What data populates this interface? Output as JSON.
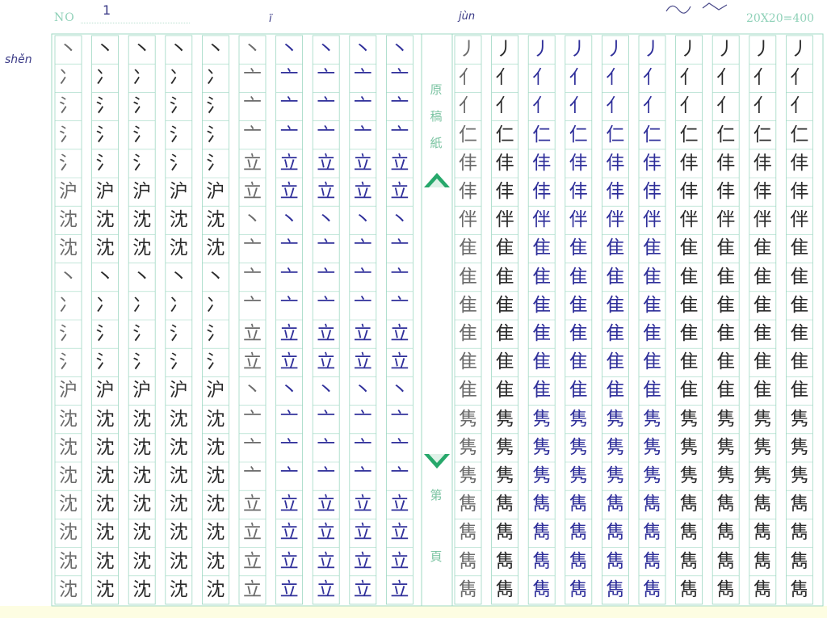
{
  "header": {
    "no_label": "NO",
    "count_label": "20X20=400"
  },
  "annotations": {
    "no_value": "1",
    "pinyin_left": "shěn",
    "pinyin_mid1": "ï",
    "pinyin_mid2": "jùn"
  },
  "gutter": {
    "top": [
      "原",
      "稿",
      "紙"
    ],
    "bottom": [
      "第",
      "頁"
    ]
  },
  "colors": {
    "grid_line": "#9fd8c3",
    "accent_green": "#7cc4a3",
    "ink_black": "#2b2b2b",
    "ink_blue": "#2f2f9a",
    "ink_faint": "#6b6b6b"
  },
  "rows": 20,
  "columns": [
    {
      "ink": "faint",
      "chars": [
        "丶",
        "冫",
        "氵",
        "氵",
        "氵⺄",
        "沪",
        "沈",
        "沈",
        "丶",
        "冫",
        "氵",
        "氵⺄",
        "沪",
        "沈",
        "沈",
        "沈",
        "沈",
        "沈",
        "沈",
        "沈"
      ]
    },
    {
      "ink": "black",
      "chars": [
        "丶",
        "冫",
        "氵",
        "氵",
        "氵⺄",
        "沪",
        "沈",
        "沈",
        "丶",
        "冫",
        "氵",
        "氵⺄",
        "沪",
        "沈",
        "沈",
        "沈",
        "沈",
        "沈",
        "沈",
        "沈"
      ]
    },
    {
      "ink": "black",
      "chars": [
        "丶",
        "冫",
        "氵",
        "氵",
        "氵⺄",
        "沪",
        "沈",
        "沈",
        "丶",
        "冫",
        "氵",
        "氵⺄",
        "沪",
        "沈",
        "沈",
        "沈",
        "沈",
        "沈",
        "沈",
        "沈"
      ]
    },
    {
      "ink": "black",
      "chars": [
        "丶",
        "冫",
        "氵",
        "氵",
        "氵⺄",
        "沪",
        "沈",
        "沈",
        "丶",
        "冫",
        "氵",
        "氵⺄",
        "沪",
        "沈",
        "沈",
        "沈",
        "沈",
        "沈",
        "沈",
        "沈"
      ]
    },
    {
      "ink": "black",
      "chars": [
        "丶",
        "冫",
        "氵",
        "氵",
        "氵⺄",
        "沪",
        "沈",
        "沈",
        "丶",
        "冫",
        "氵",
        "氵⺄",
        "沪",
        "沈",
        "沈",
        "沈",
        "沈",
        "沈",
        "沈",
        "沈"
      ]
    },
    {
      "ink": "faint",
      "chars": [
        "丶",
        "亠",
        "亠",
        "亠",
        "立",
        "立",
        "丶",
        "亠",
        "亠",
        "亠",
        "立",
        "立",
        "丶",
        "亠",
        "亠",
        "亠",
        "立",
        "立",
        "立",
        "立"
      ]
    },
    {
      "ink": "blue",
      "chars": [
        "丶",
        "亠",
        "亠",
        "亠",
        "立",
        "立",
        "丶",
        "亠",
        "亠",
        "亠",
        "立",
        "立",
        "丶",
        "亠",
        "亠",
        "亠",
        "立",
        "立",
        "立",
        "立"
      ]
    },
    {
      "ink": "blue",
      "chars": [
        "丶",
        "亠",
        "亠",
        "亠",
        "立",
        "立",
        "丶",
        "亠",
        "亠",
        "亠",
        "立",
        "立",
        "丶",
        "亠",
        "亠",
        "亠",
        "立",
        "立",
        "立",
        "立"
      ]
    },
    {
      "ink": "blue",
      "chars": [
        "丶",
        "亠",
        "亠",
        "亠",
        "立",
        "立",
        "丶",
        "亠",
        "亠",
        "亠",
        "立",
        "立",
        "丶",
        "亠",
        "亠",
        "亠",
        "立",
        "立",
        "立",
        "立"
      ]
    },
    {
      "ink": "blue",
      "chars": [
        "丶",
        "亠",
        "亠",
        "亠",
        "立",
        "立",
        "丶",
        "亠",
        "亠",
        "亠",
        "立",
        "立",
        "丶",
        "亠",
        "亠",
        "亠",
        "立",
        "立",
        "立",
        "立"
      ]
    },
    {
      "ink": "faint",
      "chars": [
        "丿",
        "亻",
        "亻",
        "仁",
        "仹",
        "仹",
        "伴",
        "隹",
        "隹",
        "隹",
        "隹",
        "隹",
        "隹",
        "隽",
        "隽",
        "隽",
        "雋",
        "雋",
        "雋",
        "雋"
      ]
    },
    {
      "ink": "black",
      "chars": [
        "丿",
        "亻",
        "亻",
        "仁",
        "仹",
        "仹",
        "伴",
        "隹",
        "隹",
        "隹",
        "隹",
        "隹",
        "隹",
        "隽",
        "隽",
        "隽",
        "雋",
        "雋",
        "雋",
        "雋"
      ]
    },
    {
      "ink": "blue",
      "chars": [
        "丿",
        "亻",
        "亻",
        "仁",
        "仹",
        "仹",
        "伴",
        "隹",
        "隹",
        "隹",
        "隹",
        "隹",
        "隹",
        "隽",
        "隽",
        "隽",
        "雋",
        "雋",
        "雋",
        "雋"
      ]
    },
    {
      "ink": "blue",
      "chars": [
        "丿",
        "亻",
        "亻",
        "仁",
        "仹",
        "仹",
        "伴",
        "隹",
        "隹",
        "隹",
        "隹",
        "隹",
        "隹",
        "隽",
        "隽",
        "隽",
        "雋",
        "雋",
        "雋",
        "雋"
      ]
    },
    {
      "ink": "blue",
      "chars": [
        "丿",
        "亻",
        "亻",
        "仁",
        "仹",
        "仹",
        "伴",
        "隹",
        "隹",
        "隹",
        "隹",
        "隹",
        "隹",
        "隽",
        "隽",
        "隽",
        "雋",
        "雋",
        "雋",
        "雋"
      ]
    },
    {
      "ink": "blue",
      "chars": [
        "丿",
        "亻",
        "亻",
        "仁",
        "仹",
        "仹",
        "伴",
        "隹",
        "隹",
        "隹",
        "隹",
        "隹",
        "隹",
        "隽",
        "隽",
        "隽",
        "雋",
        "雋",
        "雋",
        "雋"
      ]
    },
    {
      "ink": "black",
      "chars": [
        "丿",
        "亻",
        "亻",
        "仁",
        "仹",
        "仹",
        "伴",
        "隹",
        "隹",
        "隹",
        "隹",
        "隹",
        "隹",
        "隽",
        "隽",
        "隽",
        "雋",
        "雋",
        "雋",
        "雋"
      ]
    },
    {
      "ink": "black",
      "chars": [
        "丿",
        "亻",
        "亻",
        "仁",
        "仹",
        "仹",
        "伴",
        "隹",
        "隹",
        "隹",
        "隹",
        "隹",
        "隹",
        "隽",
        "隽",
        "隽",
        "雋",
        "雋",
        "雋",
        "雋"
      ]
    },
    {
      "ink": "black",
      "chars": [
        "丿",
        "亻",
        "亻",
        "仁",
        "仹",
        "仹",
        "伴",
        "隹",
        "隹",
        "隹",
        "隹",
        "隹",
        "隹",
        "隽",
        "隽",
        "隽",
        "雋",
        "雋",
        "雋",
        "雋"
      ]
    },
    {
      "ink": "black",
      "chars": [
        "丿",
        "亻",
        "亻",
        "仁",
        "仹",
        "仹",
        "伴",
        "隹",
        "隹",
        "隹",
        "隹",
        "隹",
        "隹",
        "隽",
        "隽",
        "隽",
        "雋",
        "雋",
        "雋",
        "雋"
      ]
    }
  ]
}
